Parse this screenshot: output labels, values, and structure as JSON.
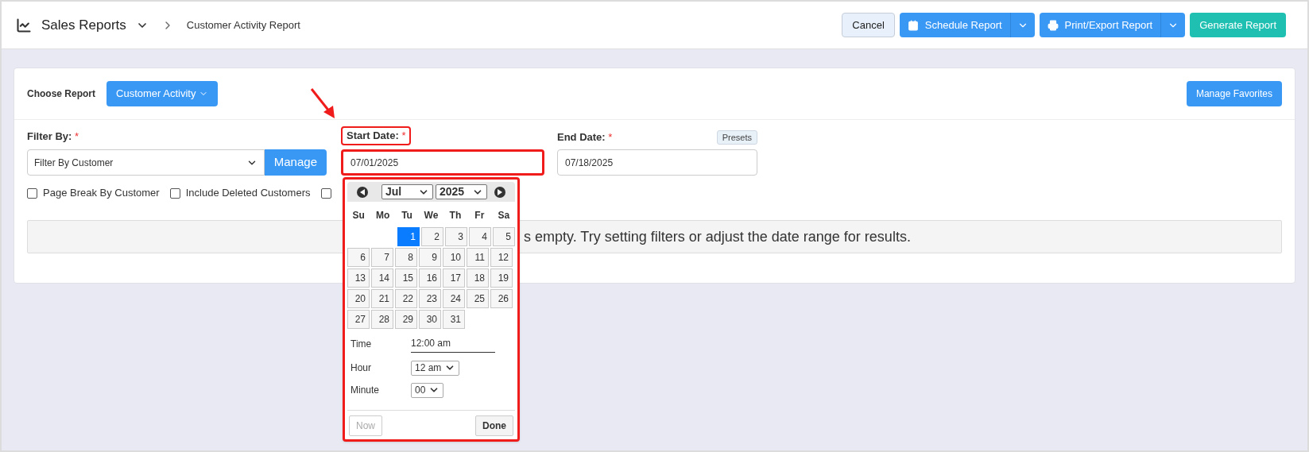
{
  "header": {
    "title": "Sales Reports",
    "breadcrumb": "Customer Activity Report"
  },
  "actions": [
    {
      "label": "Cancel",
      "kind": "plain"
    },
    {
      "label": "Schedule Report",
      "kind": "split"
    },
    {
      "label": "Print/Export Report",
      "kind": "split"
    },
    {
      "label": "Generate Report",
      "kind": "primary"
    }
  ],
  "report": {
    "label": "Choose Report",
    "value": "Customer Activity",
    "favorites": "Manage Favorites"
  },
  "filter": {
    "label": "Filter By:",
    "required": "*",
    "value": "Filter By Customer",
    "manage": "Manage"
  },
  "start_date": {
    "label": "Start Date:",
    "required": "*",
    "value": "07/01/2025",
    "highlighted": true
  },
  "end_date": {
    "label": "End Date:",
    "required": "*",
    "value": "07/18/2025",
    "presets": "Presets"
  },
  "options": [
    {
      "label": "Page Break By Customer",
      "checked": false
    },
    {
      "label": "Include Deleted Customers",
      "checked": false
    },
    {
      "checked": false
    }
  ],
  "message": "s empty. Try setting filters or adjust the date range for results.",
  "calendar": {
    "month": "Jul",
    "year": "2025",
    "weekdays": [
      "Su",
      "Mo",
      "Tu",
      "We",
      "Th",
      "Fr",
      "Sa"
    ],
    "weeks": [
      {
        "days": [
          {
            "label": "1",
            "selected": true
          },
          {
            "label": "2",
            "selected": false
          },
          {
            "label": "3",
            "selected": false
          },
          {
            "label": "4",
            "selected": false
          },
          {
            "label": "5",
            "selected": false
          }
        ]
      },
      {
        "days": [
          {
            "label": "6",
            "selected": false
          },
          {
            "label": "7",
            "selected": false
          },
          {
            "label": "8",
            "selected": false
          },
          {
            "label": "9",
            "selected": false
          },
          {
            "label": "10",
            "selected": false
          },
          {
            "label": "11",
            "selected": false
          },
          {
            "label": "12",
            "selected": false
          }
        ]
      },
      {
        "days": [
          {
            "label": "13",
            "selected": false
          },
          {
            "label": "14",
            "selected": false
          },
          {
            "label": "15",
            "selected": false
          },
          {
            "label": "16",
            "selected": false
          },
          {
            "label": "17",
            "selected": false
          },
          {
            "label": "18",
            "selected": false
          },
          {
            "label": "19",
            "selected": false
          }
        ]
      },
      {
        "days": [
          {
            "label": "20",
            "selected": false
          },
          {
            "label": "21",
            "selected": false
          },
          {
            "label": "22",
            "selected": false
          },
          {
            "label": "23",
            "selected": false
          },
          {
            "label": "24",
            "selected": false
          },
          {
            "label": "25",
            "selected": false
          },
          {
            "label": "26",
            "selected": false
          }
        ]
      },
      {
        "days": [
          {
            "label": "27",
            "selected": false
          },
          {
            "label": "28",
            "selected": false
          },
          {
            "label": "29",
            "selected": false
          },
          {
            "label": "30",
            "selected": false
          },
          {
            "label": "31",
            "selected": false
          }
        ]
      }
    ],
    "time": {
      "label": "Time",
      "value": "12:00 am"
    },
    "hour": {
      "label": "Hour",
      "value": "12 am"
    },
    "minute": {
      "label": "Minute",
      "value": "00"
    },
    "buttons": [
      {
        "label": "Now",
        "disabled": true
      },
      {
        "label": "Done",
        "disabled": false
      }
    ]
  }
}
